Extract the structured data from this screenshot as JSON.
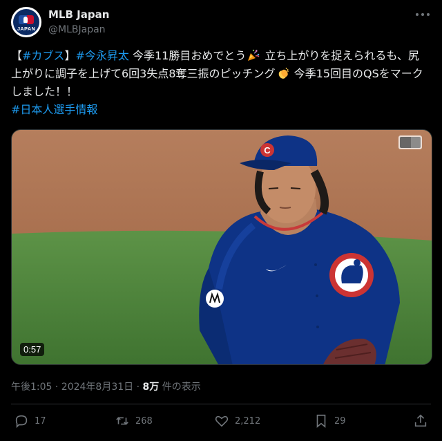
{
  "account": {
    "display_name": "MLB Japan",
    "handle": "@MLBJapan",
    "avatar_text": "JAPAN"
  },
  "tweet": {
    "p1": "【",
    "tag1": "#カブス",
    "p2": "】",
    "tag2": "#今永昇太",
    "p3": " 今季11勝目おめでとう",
    "p4": " 立ち上がりを捉えられるも、尻上がりに調子を上げて6回3失点8奪三振のピッチング",
    "p5": " 今季15回目のQSをマークしました！！",
    "tag3": "#日本人選手情報",
    "emoji1": "party-popper-icon",
    "emoji2": "clapping-hands-icon"
  },
  "media": {
    "duration": "0:57",
    "colors": {
      "cubs_blue": "#0e3386",
      "cubs_red": "#cc3433"
    }
  },
  "meta": {
    "datetime": "午後1:05 · 2024年8月31日 · ",
    "views_count": "8万",
    "views_label": " 件の表示"
  },
  "actions": {
    "replies": "17",
    "reposts": "268",
    "likes": "2,212",
    "bookmarks": "29"
  }
}
